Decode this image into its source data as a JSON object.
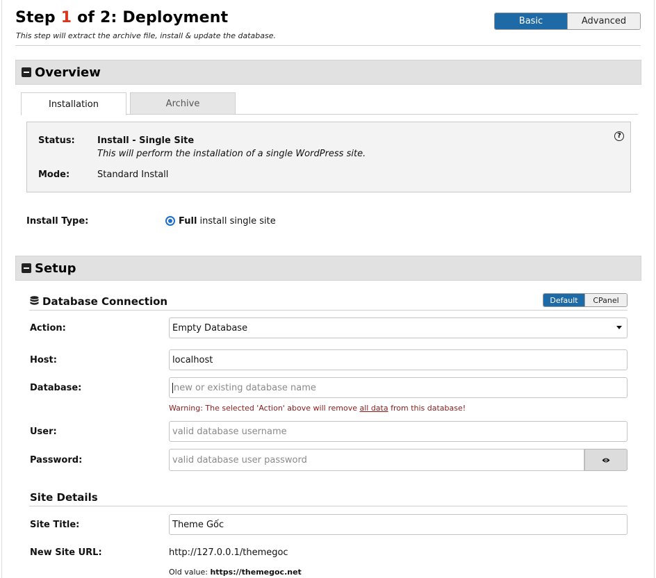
{
  "header": {
    "title_step": "Step",
    "title_num": "1",
    "title_rest": "of 2: Deployment",
    "subtitle": "This step will extract the archive file, install & update the database.",
    "mode_basic": "Basic",
    "mode_advanced": "Advanced"
  },
  "overview": {
    "heading": "Overview",
    "tabs": [
      "Installation",
      "Archive"
    ],
    "status_label": "Status:",
    "status_value": "Install - Single Site",
    "status_desc": "This will perform the installation of a single WordPress site.",
    "mode_label": "Mode:",
    "mode_value": "Standard Install",
    "help_glyph": "?",
    "install_type_label": "Install Type:",
    "install_type_bold": "Full",
    "install_type_rest": "install single site"
  },
  "setup": {
    "heading": "Setup",
    "db": {
      "heading": "Database Connection",
      "toggle_default": "Default",
      "toggle_cpanel": "CPanel",
      "action_label": "Action:",
      "action_value": "Empty Database",
      "host_label": "Host:",
      "host_value": "localhost",
      "database_label": "Database:",
      "database_placeholder": "new or existing database name",
      "warn_pre": "Warning: The selected 'Action' above will remove ",
      "warn_link": "all data",
      "warn_post": " from this database!",
      "user_label": "User:",
      "user_placeholder": "valid database username",
      "password_label": "Password:",
      "password_placeholder": "valid database user password"
    },
    "site": {
      "heading": "Site Details",
      "title_label": "Site Title:",
      "title_value": "Theme Gốc",
      "url_label": "New Site URL:",
      "url_value": "http://127.0.0.1/themegoc",
      "old_value_label": "Old value:",
      "old_value": "https://themegoc.net"
    }
  },
  "icons": {
    "section_toggle": "minus-square-icon",
    "database": "database-icon",
    "help": "question-circle-icon",
    "password_toggle": "eye-icon",
    "select": "caret-down-icon"
  },
  "colors": {
    "accent": "#1e6aa6",
    "step_number": "#d9341f",
    "warning": "#8b1a1a",
    "section_bg": "#e1e1e1"
  }
}
